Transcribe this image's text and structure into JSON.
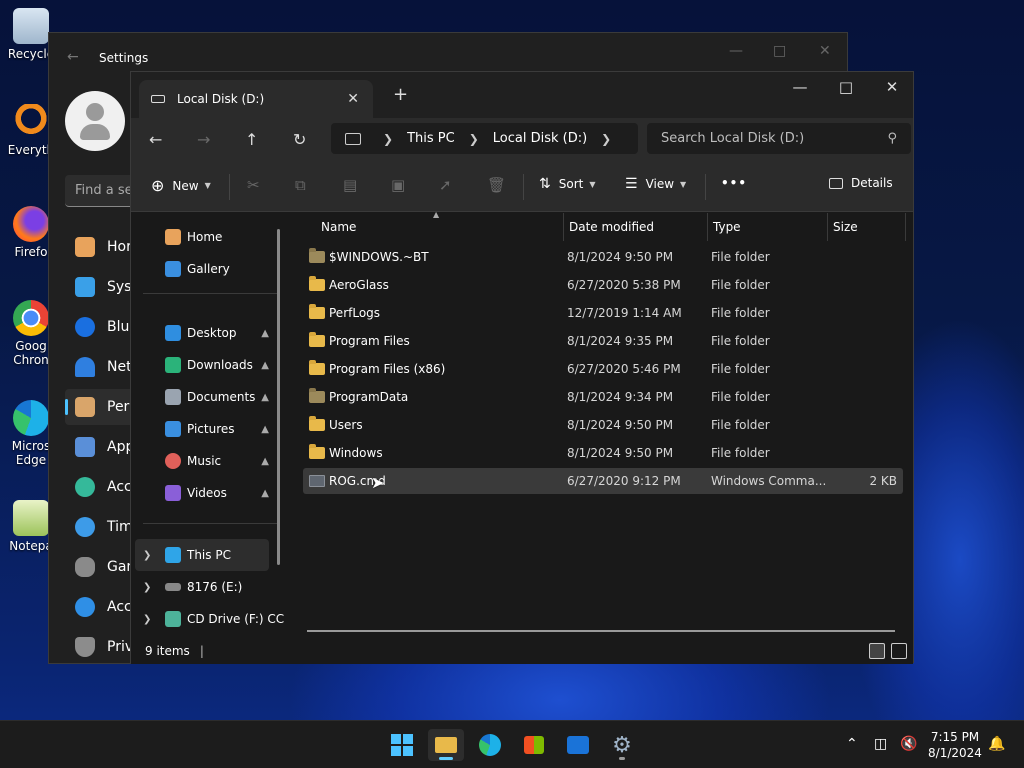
{
  "desktop": {
    "icons": [
      {
        "label": "Recycle"
      },
      {
        "label": "Everyth"
      },
      {
        "label": "Firefo"
      },
      {
        "label": "Goog Chron"
      },
      {
        "label": "Micros Edge"
      },
      {
        "label": "Notepa"
      }
    ]
  },
  "settings": {
    "title": "Settings",
    "search_placeholder": "Find a se",
    "nav": [
      "Hor",
      "Syst",
      "Blue",
      "Net",
      "Pers",
      "App",
      "Acc",
      "Tim",
      "Gan",
      "Acc",
      "Priv"
    ]
  },
  "explorer": {
    "tab_title": "Local Disk (D:)",
    "breadcrumb": [
      "This PC",
      "Local Disk (D:)"
    ],
    "search_placeholder": "Search Local Disk (D:)",
    "commands": {
      "new": "New",
      "sort": "Sort",
      "view": "View",
      "more": "•••",
      "details": "Details"
    },
    "nav_pane": {
      "top": [
        {
          "label": "Home"
        },
        {
          "label": "Gallery"
        }
      ],
      "quick_access": [
        {
          "label": "Desktop"
        },
        {
          "label": "Downloads"
        },
        {
          "label": "Documents"
        },
        {
          "label": "Pictures"
        },
        {
          "label": "Music"
        },
        {
          "label": "Videos"
        }
      ],
      "drives": [
        {
          "label": "This PC"
        },
        {
          "label": "8176 (E:)"
        },
        {
          "label": "CD Drive (F:) CC"
        }
      ]
    },
    "columns": {
      "name": "Name",
      "date": "Date modified",
      "type": "Type",
      "size": "Size"
    },
    "files": [
      {
        "name": "$WINDOWS.~BT",
        "date": "8/1/2024 9:50 PM",
        "type": "File folder",
        "size": ""
      },
      {
        "name": "AeroGlass",
        "date": "6/27/2020 5:38 PM",
        "type": "File folder",
        "size": ""
      },
      {
        "name": "PerfLogs",
        "date": "12/7/2019 1:14 AM",
        "type": "File folder",
        "size": ""
      },
      {
        "name": "Program Files",
        "date": "8/1/2024 9:35 PM",
        "type": "File folder",
        "size": ""
      },
      {
        "name": "Program Files (x86)",
        "date": "6/27/2020 5:46 PM",
        "type": "File folder",
        "size": ""
      },
      {
        "name": "ProgramData",
        "date": "8/1/2024 9:34 PM",
        "type": "File folder",
        "size": ""
      },
      {
        "name": "Users",
        "date": "8/1/2024 9:50 PM",
        "type": "File folder",
        "size": ""
      },
      {
        "name": "Windows",
        "date": "8/1/2024 9:50 PM",
        "type": "File folder",
        "size": ""
      },
      {
        "name": "ROG.cmd",
        "date": "6/27/2020 9:12 PM",
        "type": "Windows Comma...",
        "size": "2 KB"
      }
    ],
    "status": "9 items"
  },
  "taskbar": {
    "time": "7:15 PM",
    "date": "8/1/2024"
  },
  "colors": {
    "accent": "#60cdff",
    "folder": "#e8b94a"
  }
}
